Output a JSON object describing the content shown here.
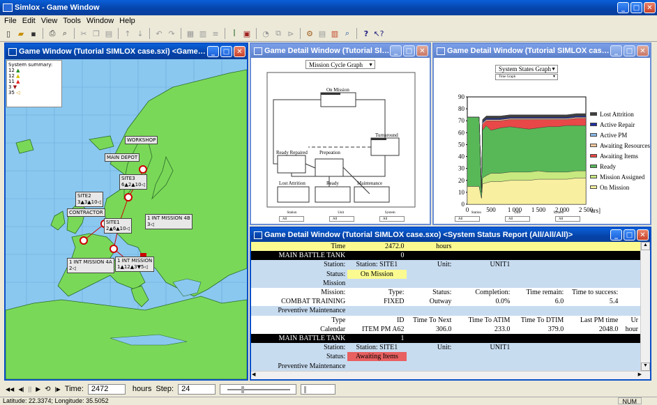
{
  "app": {
    "title": "Simlox - Game Window"
  },
  "menu": [
    "File",
    "Edit",
    "View",
    "Tools",
    "Window",
    "Help"
  ],
  "toolbar_icons": [
    "new-icon",
    "open-icon",
    "save-icon",
    "print-icon",
    "preview-icon",
    "cut-icon",
    "copy-icon",
    "paste-icon",
    "sort-asc-icon",
    "sort-desc-icon",
    "undo-icon",
    "redo-icon",
    "table-icon",
    "grid-icon",
    "list-icon",
    "tree-icon",
    "report-icon",
    "graph-icon",
    "network-icon",
    "wizard-icon",
    "tools-icon",
    "chart-icon",
    "help-icon",
    "whats-this-icon"
  ],
  "map_window": {
    "title": "Game Window (Tutorial SIMLOX case.sxi) <Game Organizatio...",
    "summary": {
      "title": "System summary:",
      "rows": [
        {
          "count": "12",
          "symbol": "▲",
          "color": "#1a8a1a"
        },
        {
          "count": "12",
          "symbol": "▲",
          "color": "#d8c000"
        },
        {
          "count": "11",
          "symbol": "▲",
          "color": "#e02020"
        },
        {
          "count": "3",
          "symbol": "▼",
          "color": "#a01010"
        },
        {
          "count": "35",
          "symbol": "◁",
          "color": "#c89000"
        }
      ]
    },
    "sites": [
      {
        "name": "WORKSHOP"
      },
      {
        "name": "MAIN DEPOT"
      },
      {
        "name": "SITE3",
        "stats": "6▲2▲10◁"
      },
      {
        "name": "SITE2",
        "stats": "3▲3▲10◁"
      },
      {
        "name": "CONTRACTOR"
      },
      {
        "name": "SITE1",
        "stats": "2▲6▲10◁"
      },
      {
        "name": "1 INT MISSION 4B",
        "stats": "3◁"
      },
      {
        "name": "1 INT MISSION 4A",
        "stats": "2◁"
      },
      {
        "name": "1 INT MISSION",
        "stats": "1▲12▲3▼5◁"
      }
    ]
  },
  "cycle_window": {
    "title": "Game Detail Window (Tutorial SIMLOX ca...",
    "graph_select": "Mission Cycle Graph",
    "nodes": [
      "On Mission",
      "Turnaround",
      "Ready Repaired",
      "Prepeation",
      "Lost Attrition",
      "Ready",
      "Maintenance"
    ],
    "filters": [
      "Station",
      "Unit",
      "System"
    ],
    "filter_values": [
      "All",
      "All",
      "All"
    ]
  },
  "states_window": {
    "title": "Game Detail Window (Tutorial SIMLOX case.sxo) <Syst...",
    "graph_select": "System States Graph",
    "sub_select": "Time Graph",
    "filters": [
      "Station",
      "Unit",
      "System"
    ],
    "filter_values": [
      "All",
      "All",
      "All"
    ],
    "axis_suffix": "urs]"
  },
  "chart_data": {
    "type": "area",
    "title": "",
    "xlabel": "",
    "ylabel": "",
    "xlim": [
      0,
      2500
    ],
    "ylim": [
      0,
      90
    ],
    "x_ticks": [
      "0",
      "500",
      "1 000",
      "1 500",
      "2 000",
      "2 500"
    ],
    "y_ticks": [
      "0",
      "10",
      "20",
      "30",
      "40",
      "50",
      "60",
      "70",
      "80",
      "90"
    ],
    "x": [
      0,
      250,
      300,
      320,
      400,
      500,
      700,
      900,
      1100,
      1300,
      1500,
      1700,
      1900,
      2100,
      2300,
      2500
    ],
    "series": [
      {
        "name": "On Mission",
        "color": "#f8f0a0",
        "values": [
          15,
          15,
          5,
          17,
          18,
          19,
          19,
          20,
          20,
          20,
          21,
          21,
          21,
          21,
          22,
          22
        ]
      },
      {
        "name": "Mission Assigned",
        "color": "#c8e880",
        "values": [
          0,
          0,
          0,
          5,
          6,
          7,
          7,
          7,
          7,
          7,
          7,
          6,
          6,
          6,
          6,
          6
        ]
      },
      {
        "name": "Ready",
        "color": "#58b858",
        "values": [
          58,
          58,
          5,
          40,
          42,
          36,
          38,
          38,
          37,
          36,
          36,
          38,
          38,
          39,
          38,
          38
        ]
      },
      {
        "name": "Awaiting Items",
        "color": "#e84848",
        "values": [
          0,
          0,
          0,
          5,
          4,
          8,
          6,
          6,
          7,
          8,
          7,
          6,
          6,
          5,
          6,
          6
        ]
      },
      {
        "name": "Awaiting Resources",
        "color": "#f8c8a0",
        "values": [
          0,
          0,
          0,
          1,
          1,
          1,
          1,
          1,
          1,
          1,
          1,
          1,
          1,
          1,
          1,
          1
        ]
      },
      {
        "name": "Active PM",
        "color": "#8ab8e8",
        "values": [
          0,
          0,
          0,
          0,
          0,
          0,
          0,
          0,
          0,
          0,
          0,
          0,
          0,
          0,
          0,
          0
        ]
      },
      {
        "name": "Active Repair",
        "color": "#2030a0",
        "values": [
          0,
          0,
          0,
          1,
          1,
          1,
          1,
          1,
          1,
          1,
          1,
          1,
          1,
          1,
          1,
          1
        ]
      },
      {
        "name": "Lost Attrition",
        "color": "#404040",
        "values": [
          0,
          0,
          0,
          2,
          2,
          2,
          2,
          2,
          2,
          2,
          2,
          2,
          2,
          2,
          2,
          2
        ]
      }
    ]
  },
  "report_window": {
    "title": "Game Detail Window (Tutorial SIMLOX case.sxo) <System Status Report (All/All/All)>",
    "rows": [
      {
        "style": "yellow",
        "cells": [
          "Time",
          "2472.0",
          "hours",
          "",
          "",
          "",
          ""
        ]
      },
      {
        "style": "black",
        "cells": [
          "MAIN BATTLE TANK",
          "0",
          "",
          "",
          "",
          "",
          ""
        ]
      },
      {
        "style": "blue",
        "cells": [
          "Station:",
          "Station: SITE1",
          "Unit:",
          "UNIT1",
          "",
          "",
          ""
        ]
      },
      {
        "style": "blue",
        "cells": [
          "Status:",
          "On Mission",
          "",
          "",
          "",
          "",
          ""
        ],
        "highlight": "yellow"
      },
      {
        "style": "blue",
        "cells": [
          "Mission",
          "",
          "",
          "",
          "",
          "",
          ""
        ]
      },
      {
        "style": "white",
        "cells": [
          "Mission:",
          "Type:",
          "Status:",
          "Completion:",
          "Time remain:",
          "Time to success:",
          ""
        ]
      },
      {
        "style": "white",
        "cells": [
          "COMBAT TRAINING",
          "FIXED",
          "Outway",
          "0.0%",
          "6.0",
          "5.4",
          ""
        ]
      },
      {
        "style": "blue",
        "cells": [
          "Preventive Maintenance",
          "",
          "",
          "",
          "",
          "",
          ""
        ]
      },
      {
        "style": "white",
        "cells": [
          "Type",
          "ID",
          "Time To Next",
          "Time To ATIM",
          "Time To DTIM",
          "Last PM time",
          "Ur"
        ]
      },
      {
        "style": "white",
        "cells": [
          "Calendar",
          "ITEM PM A62",
          "306.0",
          "233.0",
          "379.0",
          "2048.0",
          "hour"
        ]
      },
      {
        "style": "black",
        "cells": [
          "MAIN BATTLE TANK",
          "1",
          "",
          "",
          "",
          "",
          ""
        ]
      },
      {
        "style": "blue",
        "cells": [
          "Station:",
          "Station: SITE1",
          "Unit:",
          "UNIT1",
          "",
          "",
          ""
        ]
      },
      {
        "style": "blue",
        "cells": [
          "Status:",
          "Awaiting Items",
          "",
          "",
          "",
          "",
          ""
        ],
        "highlight": "red"
      },
      {
        "style": "blue",
        "cells": [
          "Preventive Maintenance",
          "",
          "",
          "",
          "",
          "",
          ""
        ]
      }
    ]
  },
  "bottom": {
    "time_label": "Time:",
    "time_value": "2472",
    "hours_label": "hours",
    "step_label": "Step:",
    "step_value": "24"
  },
  "status": {
    "coords": "Latitude: 22.3374; Longitude: 35.5052",
    "num": "NUM"
  }
}
